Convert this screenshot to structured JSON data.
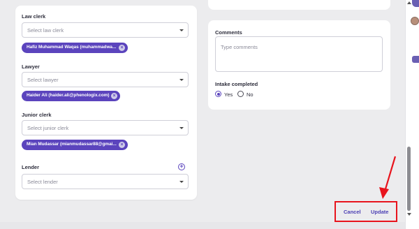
{
  "left_card": {
    "law_clerk": {
      "label": "Law clerk",
      "placeholder": "Select law clerk",
      "chip": "Hafiz Muhammad Waqas (muhammadwa..."
    },
    "lawyer": {
      "label": "Lawyer",
      "placeholder": "Select lawyer",
      "chip": "Haider Ali (haider.ali@phenologix.com)"
    },
    "junior_clerk": {
      "label": "Junior clerk",
      "placeholder": "Select junior clerk",
      "chip": "Mian Mudassar (mianmudassar88@gmai..."
    },
    "lender": {
      "label": "Lender",
      "placeholder": "Select lender"
    }
  },
  "right_card": {
    "comments": {
      "label": "Comments",
      "placeholder": "Type comments"
    },
    "intake": {
      "label": "Intake completed",
      "options": [
        "Yes",
        "No"
      ],
      "selected": "Yes"
    }
  },
  "actions": {
    "cancel": "Cancel",
    "update": "Update"
  },
  "icons": {
    "chip_remove": "close-circle-icon",
    "dropdown": "chevron-down-icon",
    "add": "plus-circle-icon"
  },
  "colors": {
    "accent": "#5b44bd",
    "annotation": "#e8141d"
  }
}
